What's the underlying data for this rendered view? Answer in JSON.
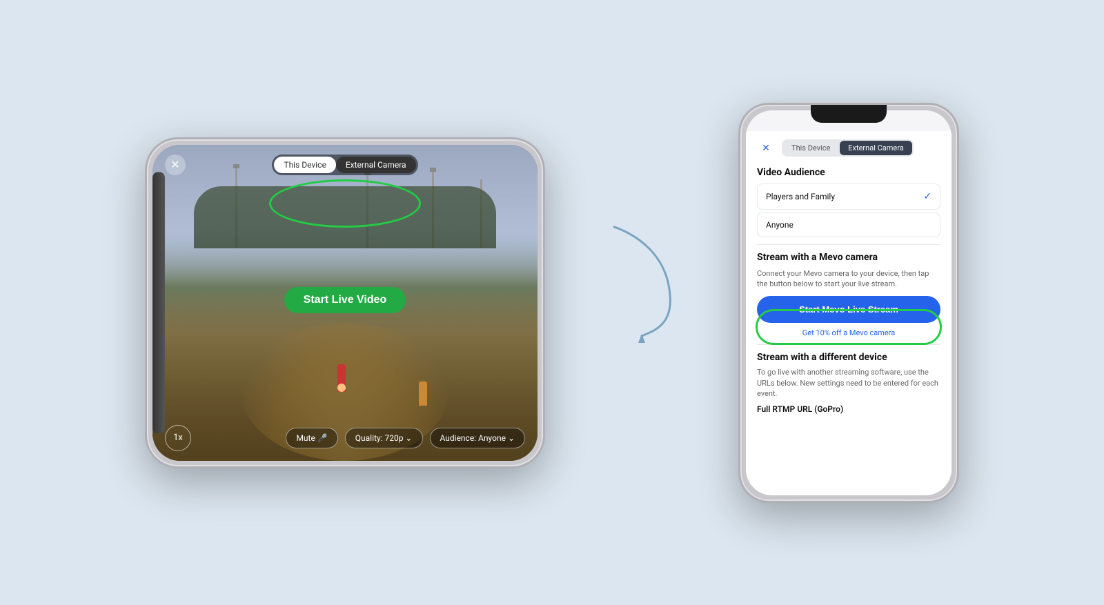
{
  "background_color": "#dce6f0",
  "phone_landscape": {
    "close_label": "✕",
    "toggle": {
      "option1": "This Device",
      "option2": "External Camera",
      "active": "External Camera"
    },
    "start_live_label": "Start Live Video",
    "zoom_label": "1x",
    "controls": {
      "mute": "Mute 🎤",
      "quality": "Quality: 720p ⌄",
      "audience": "Audience: Anyone ⌄"
    }
  },
  "phone_portrait": {
    "close_label": "✕",
    "toggle": {
      "option1": "This Device",
      "option2": "External Camera",
      "active": "External Camera"
    },
    "video_audience_label": "Video Audience",
    "audience_options": [
      {
        "label": "Players and Family",
        "selected": true
      },
      {
        "label": "Anyone",
        "selected": false
      }
    ],
    "stream_mevo_label": "Stream with a Mevo camera",
    "stream_mevo_desc": "Connect your Mevo camera to your device, then tap the button below to start your live stream.",
    "mevo_btn_label": "Start Mevo Live Stream",
    "discount_label": "Get 10% off a Mevo camera",
    "stream_diff_label": "Stream with a different device",
    "stream_diff_desc": "To go live with another streaming software, use the URLs below. New settings need to be entered for each event.",
    "rtmp_label": "Full RTMP URL (GoPro)"
  },
  "arrow": {
    "color": "#7aa4c0"
  }
}
